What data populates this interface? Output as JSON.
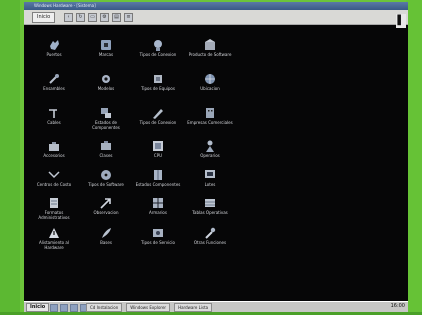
{
  "window": {
    "title": "Windows Hardware - [Sistema]"
  },
  "toolbar": {
    "start_label": "Inicio"
  },
  "taskbar": {
    "start_label": "Inicio",
    "tasks": [
      "Cd Instalacion",
      "Windows Explorer",
      "Hardware Lista"
    ],
    "clock": "16:00"
  },
  "desktop_icons": [
    {
      "label": "Puertos",
      "icon": "hand-icon"
    },
    {
      "label": "Marcas",
      "icon": "disk-icon"
    },
    {
      "label": "Tipos de Conexion",
      "icon": "network-icon"
    },
    {
      "label": "Producto de Software",
      "icon": "package-icon"
    },
    {
      "label": "Ensambles",
      "icon": "tools-icon"
    },
    {
      "label": "Modelos",
      "icon": "gear-icon"
    },
    {
      "label": "Tipos de Equipos",
      "icon": "chip-icon"
    },
    {
      "label": "Ubicacion",
      "icon": "globe-icon"
    },
    {
      "label": "Cables",
      "icon": "cable-icon"
    },
    {
      "label": "Estados de Componentes",
      "icon": "state-icon"
    },
    {
      "label": "Tipos de Conexion",
      "icon": "pencil-icon"
    },
    {
      "label": "Empresas Comerciales",
      "icon": "building-icon"
    },
    {
      "label": "Accesorios",
      "icon": "briefcase-icon"
    },
    {
      "label": "Clases",
      "icon": "toolbox-icon"
    },
    {
      "label": "CPU",
      "icon": "cpu-icon"
    },
    {
      "label": "Operarios",
      "icon": "user-icon"
    },
    {
      "label": "Centros de Costo",
      "icon": "scale-icon"
    },
    {
      "label": "Tipos de Software",
      "icon": "cd-icon"
    },
    {
      "label": "Estados Componentes",
      "icon": "book-icon"
    },
    {
      "label": "Lotes",
      "icon": "monitor-icon"
    },
    {
      "label": "Formatos Administrativos",
      "icon": "form-icon"
    },
    {
      "label": "Observacion",
      "icon": "arrow-icon"
    },
    {
      "label": "Armarios",
      "icon": "grid-icon"
    },
    {
      "label": "Tablas Operativas",
      "icon": "table-icon"
    },
    {
      "label": "Alistamiento al Hardware",
      "icon": "warning-icon"
    },
    {
      "label": "Bases",
      "icon": "feather-icon"
    },
    {
      "label": "Tipos de Servicio",
      "icon": "service-icon"
    },
    {
      "label": "Otras Funciones",
      "icon": "wrench-icon"
    }
  ]
}
